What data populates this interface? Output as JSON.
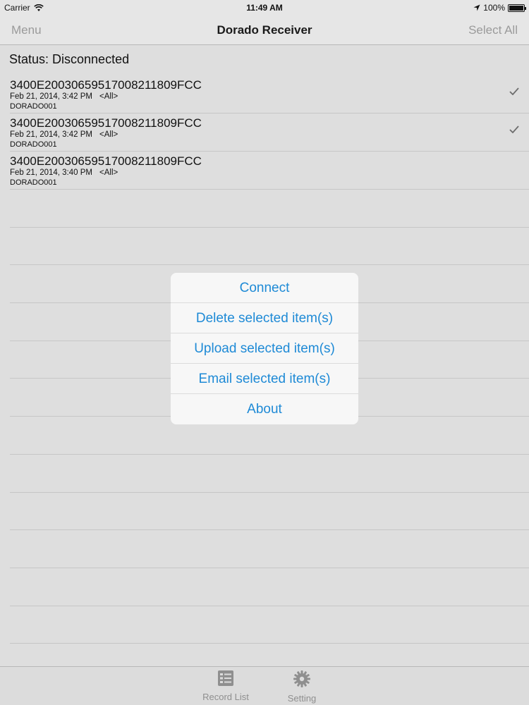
{
  "status_bar": {
    "carrier": "Carrier",
    "time": "11:49 AM",
    "battery": "100%",
    "icons": [
      "wifi-icon",
      "location-arrow-icon",
      "battery-icon"
    ]
  },
  "nav": {
    "left": "Menu",
    "title": "Dorado Receiver",
    "right": "Select All"
  },
  "status_text": "Status: Disconnected",
  "records": [
    {
      "id": "3400E200306595170082118 09FCC",
      "date": "Feb 21, 2014, 3:42 PM",
      "tag": "<All>",
      "name": "DORADO001",
      "checked": true
    },
    {
      "id": "3400E20030659517008211809FCC",
      "date": "Feb 21, 2014, 3:42 PM",
      "tag": "<All>",
      "name": "DORADO001",
      "checked": true
    },
    {
      "id": "3400E20030659517008211809FCC",
      "date": "Feb 21, 2014, 3:40 PM",
      "tag": "<All>",
      "name": "DORADO001",
      "checked": false
    }
  ],
  "menu": {
    "items": [
      "Connect",
      "Delete selected item(s)",
      "Upload selected item(s)",
      "Email selected item(s)",
      "About"
    ]
  },
  "tabs": [
    {
      "label": "Record List",
      "icon": "record-list-icon"
    },
    {
      "label": "Setting",
      "icon": "gear-icon"
    }
  ],
  "colors": {
    "accent": "#1e8ad6",
    "background": "#dedede",
    "disabled": "#9a9a9a"
  }
}
